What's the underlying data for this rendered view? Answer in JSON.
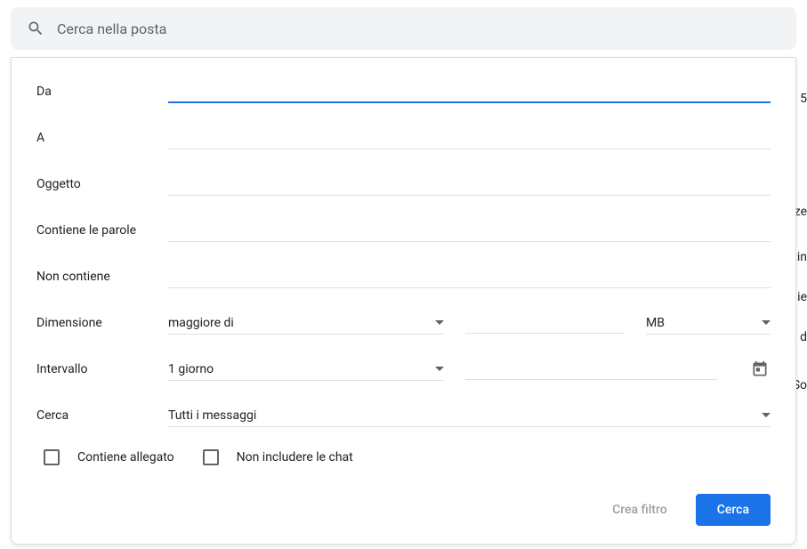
{
  "search": {
    "placeholder": "Cerca nella posta"
  },
  "form": {
    "from_label": "Da",
    "to_label": "A",
    "subject_label": "Oggetto",
    "has_words_label": "Contiene le parole",
    "not_has_label": "Non contiene",
    "size_label": "Dimensione",
    "size_operator": "maggiore di",
    "size_unit": "MB",
    "date_label": "Intervallo",
    "date_range": "1 giorno",
    "search_in_label": "Cerca",
    "search_in_value": "Tutti i messaggi",
    "has_attachment_label": "Contiene allegato",
    "exclude_chats_label": "Non includere le chat"
  },
  "buttons": {
    "create_filter": "Crea filtro",
    "search": "Cerca"
  },
  "background_fragments": {
    "f1": "5",
    "f2": "zze",
    "f3": "tin",
    "f4": "ie",
    "f5": ", d",
    "f6": "So"
  }
}
